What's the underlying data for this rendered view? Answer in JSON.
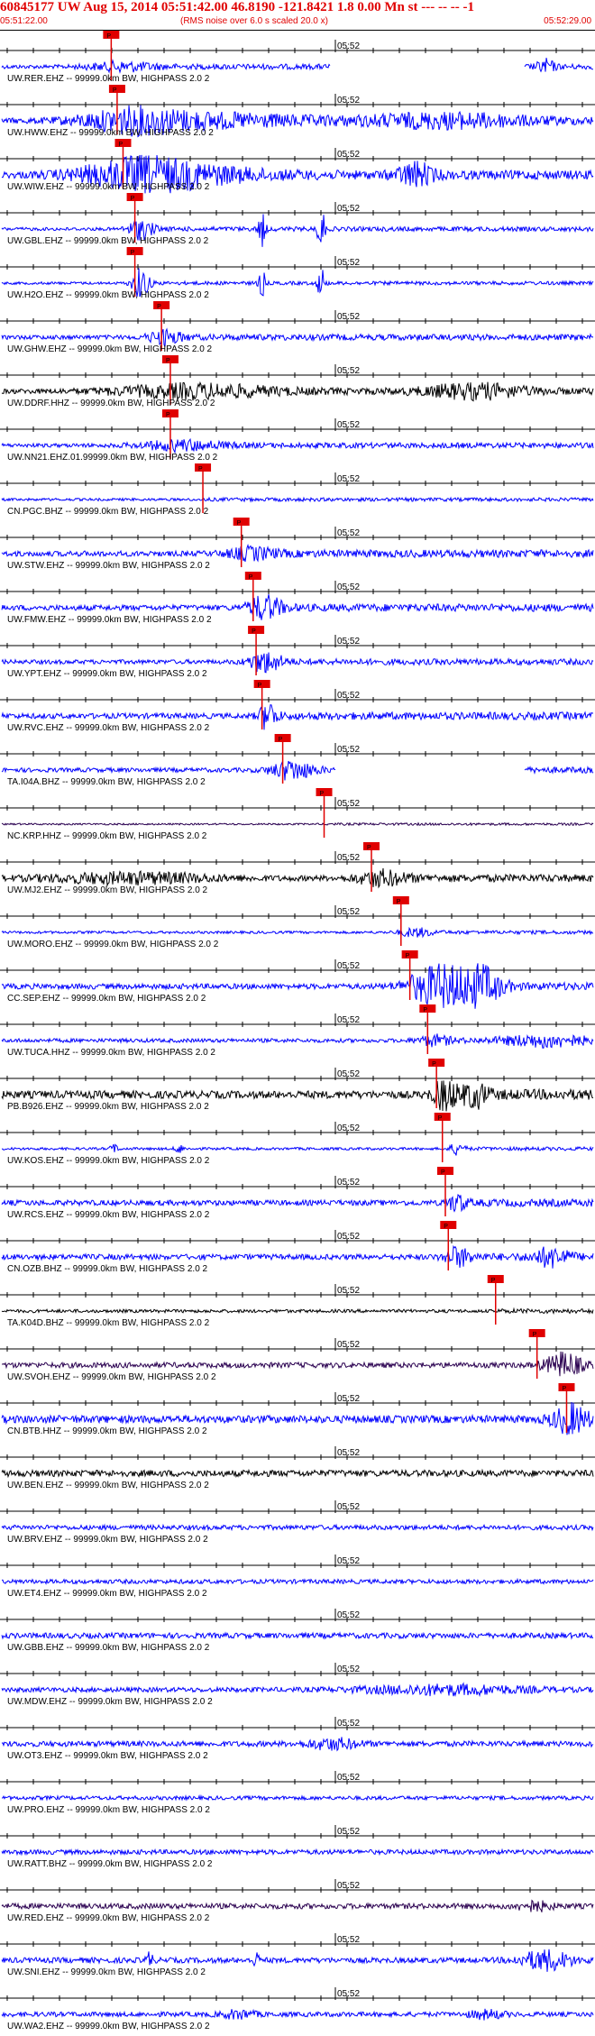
{
  "header": {
    "title": "60845177 UW Aug 15, 2014 05:51:42.00   46.8190 -121.8421  1.8 0.00 Mn st --- -- --  -1",
    "start_time": "05:51:22.00",
    "note": "(RMS noise over 6.0 s scaled 20.0 x)",
    "end_time": "05:52:29.00"
  },
  "colors": {
    "title": "#e00000",
    "trace_blue": "#0000ff",
    "trace_black": "#000000",
    "trace_purple": "#2a0050",
    "pick": "#e00000",
    "axis": "#000000"
  },
  "minute_label": "05:52",
  "pick_label": "P",
  "traces": [
    {
      "label": "UW.RER.EHZ -- 99999.0km BW, HIGHPASS  2.0  2",
      "color": "blue",
      "pick": 0.185,
      "noise": 0.18,
      "bursts": [
        [
          0.2,
          0.35,
          0.04
        ],
        [
          0.92,
          0.6,
          0.01
        ]
      ],
      "gaps": [
        [
          0.555,
          0.885
        ]
      ]
    },
    {
      "label": "UW.HWW.EHZ -- 99999.0km BW, HIGHPASS  2.0  2",
      "color": "blue",
      "pick": 0.195,
      "noise": 0.25,
      "bursts": [
        [
          0.22,
          0.85,
          0.06
        ],
        [
          0.35,
          0.5,
          0.12
        ],
        [
          0.75,
          0.55,
          0.1
        ]
      ],
      "gaps": []
    },
    {
      "label": "UW.WIW.EHZ -- 99999.0km BW, HIGHPASS  2.0  2",
      "color": "blue",
      "pick": 0.205,
      "noise": 0.3,
      "bursts": [
        [
          0.23,
          1.0,
          0.07
        ],
        [
          0.3,
          0.6,
          0.1
        ],
        [
          0.7,
          1.0,
          0.02
        ]
      ],
      "gaps": []
    },
    {
      "label": "UW.GBL.EHZ -- 99999.0km BW, HIGHPASS  2.0  2",
      "color": "blue",
      "pick": 0.225,
      "noise": 0.15,
      "bursts": [
        [
          0.235,
          0.9,
          0.015
        ],
        [
          0.44,
          1.6,
          0.004
        ],
        [
          0.54,
          2.2,
          0.004
        ]
      ],
      "gaps": []
    },
    {
      "label": "UW.H2O.EHZ -- 99999.0km BW, HIGHPASS  2.0  2",
      "color": "blue",
      "pick": 0.225,
      "noise": 0.12,
      "bursts": [
        [
          0.235,
          1.4,
          0.01
        ],
        [
          0.44,
          1.2,
          0.004
        ],
        [
          0.54,
          1.6,
          0.004
        ]
      ],
      "gaps": []
    },
    {
      "label": "UW.GHW.EHZ -- 99999.0km BW, HIGHPASS  2.0  2",
      "color": "blue",
      "pick": 0.27,
      "noise": 0.2,
      "bursts": [
        [
          0.275,
          0.6,
          0.02
        ]
      ],
      "gaps": []
    },
    {
      "label": "UW.DDRF.HHZ -- 99999.0km BW, HIGHPASS  2.0  2",
      "color": "black",
      "pick": 0.285,
      "noise": 0.22,
      "bursts": [
        [
          0.32,
          0.55,
          0.1
        ],
        [
          0.8,
          0.6,
          0.06
        ]
      ],
      "gaps": []
    },
    {
      "label": "UW.NN21.EHZ.01.99999.0km BW, HIGHPASS  2.0  2",
      "color": "blue",
      "pick": 0.285,
      "noise": 0.18,
      "bursts": [
        [
          0.3,
          0.4,
          0.05
        ]
      ],
      "gaps": []
    },
    {
      "label": "CN.PGC.BHZ -- 99999.0km BW, HIGHPASS  2.0  2",
      "color": "blue",
      "pick": 0.34,
      "noise": 0.12,
      "bursts": [],
      "gaps": []
    },
    {
      "label": "UW.STW.EHZ -- 99999.0km BW, HIGHPASS  2.0  2",
      "color": "blue",
      "pick": 0.405,
      "noise": 0.25,
      "bursts": [
        [
          0.42,
          0.45,
          0.03
        ]
      ],
      "gaps": []
    },
    {
      "label": "UW.FMW.EHZ -- 99999.0km BW, HIGHPASS  2.0  2",
      "color": "blue",
      "pick": 0.425,
      "noise": 0.25,
      "bursts": [
        [
          0.445,
          1.0,
          0.02
        ]
      ],
      "gaps": []
    },
    {
      "label": "UW.YPT.EHZ -- 99999.0km BW, HIGHPASS  2.0  2",
      "color": "blue",
      "pick": 0.43,
      "noise": 0.2,
      "bursts": [
        [
          0.445,
          0.9,
          0.02
        ]
      ],
      "gaps": []
    },
    {
      "label": "UW.RVC.EHZ -- 99999.0km BW, HIGHPASS  2.0  2",
      "color": "blue",
      "pick": 0.44,
      "noise": 0.25,
      "bursts": [
        [
          0.45,
          1.2,
          0.01
        ]
      ],
      "gaps": []
    },
    {
      "label": "TA.I04A.BHZ -- 99999.0km BW, HIGHPASS  2.0  2",
      "color": "blue",
      "pick": 0.475,
      "noise": 0.2,
      "bursts": [
        [
          0.49,
          0.8,
          0.025
        ]
      ],
      "gaps": [
        [
          0.565,
          0.885
        ]
      ]
    },
    {
      "label": "NC.KRP.HHZ -- 99999.0km BW, HIGHPASS  2.0  2",
      "color": "purple",
      "pick": 0.545,
      "noise": 0.08,
      "bursts": [],
      "gaps": []
    },
    {
      "label": "UW.MJ2.EHZ -- 99999.0km BW, HIGHPASS  2.0  2",
      "color": "black",
      "pick": 0.625,
      "noise": 0.25,
      "bursts": [
        [
          0.22,
          0.45,
          0.1
        ],
        [
          0.64,
          0.6,
          0.03
        ]
      ],
      "gaps": []
    },
    {
      "label": "UW.MORO.EHZ -- 99999.0km BW, HIGHPASS  2.0  2",
      "color": "blue",
      "pick": 0.675,
      "noise": 0.12,
      "bursts": [
        [
          0.7,
          0.35,
          0.02
        ]
      ],
      "gaps": []
    },
    {
      "label": "CC.SEP.EHZ -- 99999.0km BW, HIGHPASS  2.0  2",
      "color": "blue",
      "pick": 0.69,
      "noise": 0.25,
      "bursts": [
        [
          0.74,
          1.8,
          0.035
        ],
        [
          0.81,
          1.6,
          0.025
        ]
      ],
      "gaps": []
    },
    {
      "label": "UW.TUCA.HHZ -- 99999.0km BW, HIGHPASS  2.0  2",
      "color": "blue",
      "pick": 0.72,
      "noise": 0.18,
      "bursts": [
        [
          0.73,
          0.4,
          0.02
        ],
        [
          0.92,
          0.5,
          0.05
        ]
      ],
      "gaps": []
    },
    {
      "label": "PB.B926.EHZ -- 99999.0km BW, HIGHPASS  2.0  2",
      "color": "black",
      "pick": 0.735,
      "noise": 0.35,
      "bursts": [
        [
          0.75,
          1.2,
          0.015
        ],
        [
          0.8,
          1.0,
          0.015
        ]
      ],
      "gaps": []
    },
    {
      "label": "UW.KOS.EHZ -- 99999.0km BW, HIGHPASS  2.0  2",
      "color": "blue",
      "pick": 0.745,
      "noise": 0.12,
      "bursts": [
        [
          0.77,
          0.5,
          0.008
        ],
        [
          0.3,
          0.4,
          0.005
        ],
        [
          0.19,
          0.35,
          0.005
        ]
      ],
      "gaps": []
    },
    {
      "label": "UW.RCS.EHZ -- 99999.0km BW, HIGHPASS  2.0  2",
      "color": "blue",
      "pick": 0.75,
      "noise": 0.25,
      "bursts": [
        [
          0.77,
          0.7,
          0.01
        ]
      ],
      "gaps": []
    },
    {
      "label": "CN.OZB.BHZ -- 99999.0km BW, HIGHPASS  2.0  2",
      "color": "blue",
      "pick": 0.755,
      "noise": 0.25,
      "bursts": [
        [
          0.77,
          0.8,
          0.015
        ],
        [
          0.93,
          0.8,
          0.02
        ]
      ],
      "gaps": []
    },
    {
      "label": "TA.K04D.BHZ -- 99999.0km BW, HIGHPASS  2.0  2",
      "color": "black",
      "pick": 0.835,
      "noise": 0.15,
      "bursts": [],
      "gaps": []
    },
    {
      "label": "UW.SVOH.EHZ -- 99999.0km BW, HIGHPASS  2.0  2",
      "color": "purple",
      "pick": 0.905,
      "noise": 0.25,
      "bursts": [
        [
          0.95,
          1.0,
          0.02
        ]
      ],
      "gaps": []
    },
    {
      "label": "CN.BTB.HHZ -- 99999.0km BW, HIGHPASS  2.0  2",
      "color": "blue",
      "pick": 0.955,
      "noise": 0.35,
      "bursts": [
        [
          0.96,
          1.2,
          0.02
        ]
      ],
      "gaps": []
    },
    {
      "label": "UW.BEN.EHZ -- 99999.0km BW, HIGHPASS  2.0  2",
      "color": "black",
      "pick": null,
      "noise": 0.3,
      "bursts": [],
      "gaps": []
    },
    {
      "label": "UW.BRV.EHZ -- 99999.0km BW, HIGHPASS  2.0  2",
      "color": "blue",
      "pick": null,
      "noise": 0.22,
      "bursts": [],
      "gaps": []
    },
    {
      "label": "UW.ET4.EHZ -- 99999.0km BW, HIGHPASS  2.0  2",
      "color": "blue",
      "pick": null,
      "noise": 0.2,
      "bursts": [],
      "gaps": []
    },
    {
      "label": "UW.GBB.EHZ -- 99999.0km BW, HIGHPASS  2.0  2",
      "color": "blue",
      "pick": null,
      "noise": 0.25,
      "bursts": [],
      "gaps": []
    },
    {
      "label": "UW.MDW.EHZ -- 99999.0km BW, HIGHPASS  2.0  2",
      "color": "blue",
      "pick": null,
      "noise": 0.22,
      "bursts": [
        [
          0.75,
          0.4,
          0.1
        ]
      ],
      "gaps": []
    },
    {
      "label": "UW.OT3.EHZ -- 99999.0km BW, HIGHPASS  2.0  2",
      "color": "blue",
      "pick": null,
      "noise": 0.25,
      "bursts": [
        [
          0.56,
          0.45,
          0.03
        ]
      ],
      "gaps": []
    },
    {
      "label": "UW.PRO.EHZ -- 99999.0km BW, HIGHPASS  2.0  2",
      "color": "blue",
      "pick": null,
      "noise": 0.18,
      "bursts": [],
      "gaps": []
    },
    {
      "label": "UW.RATT.BHZ -- 99999.0km BW, HIGHPASS  2.0  2",
      "color": "blue",
      "pick": null,
      "noise": 0.22,
      "bursts": [],
      "gaps": []
    },
    {
      "label": "UW.RED.EHZ -- 99999.0km BW, HIGHPASS  2.0  2",
      "color": "purple",
      "pick": null,
      "noise": 0.25,
      "bursts": [
        [
          0.9,
          0.4,
          0.02
        ]
      ],
      "gaps": []
    },
    {
      "label": "UW.SNI.EHZ -- 99999.0km BW, HIGHPASS  2.0  2",
      "color": "blue",
      "pick": null,
      "noise": 0.25,
      "bursts": [
        [
          0.25,
          0.7,
          0.004
        ],
        [
          0.43,
          0.6,
          0.004
        ],
        [
          0.92,
          0.9,
          0.03
        ]
      ],
      "gaps": []
    },
    {
      "label": "UW.WA2.EHZ -- 99999.0km BW, HIGHPASS  2.0  2",
      "color": "blue",
      "pick": null,
      "noise": 0.22,
      "bursts": [
        [
          0.4,
          0.35,
          0.02
        ],
        [
          0.82,
          0.35,
          0.02
        ]
      ],
      "gaps": []
    }
  ]
}
